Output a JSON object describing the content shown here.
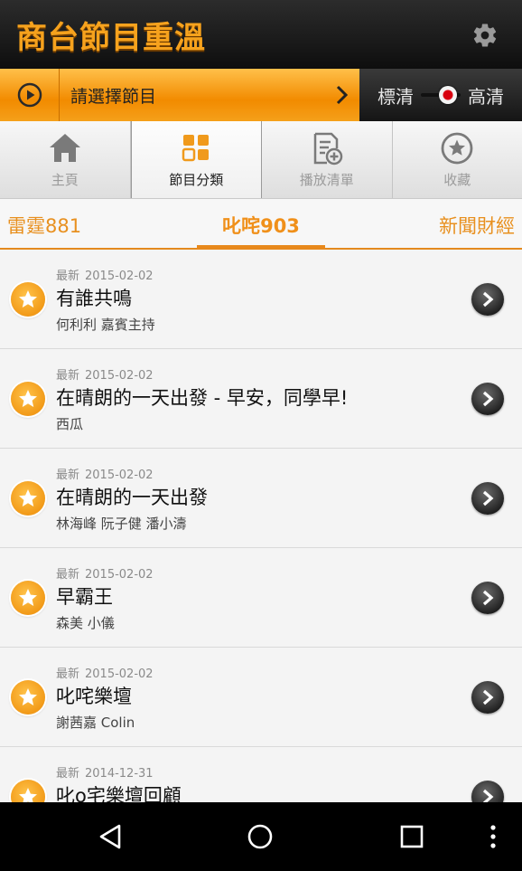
{
  "app": {
    "title": "商台節目重溫"
  },
  "selector": {
    "label": "請選擇節目",
    "quality_sd": "標清",
    "quality_hd": "高清"
  },
  "nav": [
    {
      "label": "主頁",
      "icon": "home-icon"
    },
    {
      "label": "節目分類",
      "icon": "grid-icon"
    },
    {
      "label": "播放清單",
      "icon": "playlist-add-icon"
    },
    {
      "label": "收藏",
      "icon": "star-circle-icon"
    }
  ],
  "channels": {
    "left": "雷霆881",
    "active": "叱咤903",
    "right": "新聞財經"
  },
  "programs": [
    {
      "badge": "最新",
      "date": "2015-02-02",
      "title": "有誰共鳴",
      "hosts": "何利利 嘉賓主持"
    },
    {
      "badge": "最新",
      "date": "2015-02-02",
      "title": "在晴朗的一天出發 - 早安，同學早!",
      "hosts": "西瓜"
    },
    {
      "badge": "最新",
      "date": "2015-02-02",
      "title": "在晴朗的一天出發",
      "hosts": "林海峰 阮子健 潘小濤"
    },
    {
      "badge": "最新",
      "date": "2015-02-02",
      "title": "早霸王",
      "hosts": "森美 小儀"
    },
    {
      "badge": "最新",
      "date": "2015-02-02",
      "title": "叱咤樂壇",
      "hosts": "謝茜嘉 Colin"
    },
    {
      "badge": "最新",
      "date": "2014-12-31",
      "title": "叱o宅樂壇回顧",
      "hosts": ""
    }
  ],
  "colors": {
    "accent": "#f0901a",
    "titlebar": "#1a1a1a"
  }
}
